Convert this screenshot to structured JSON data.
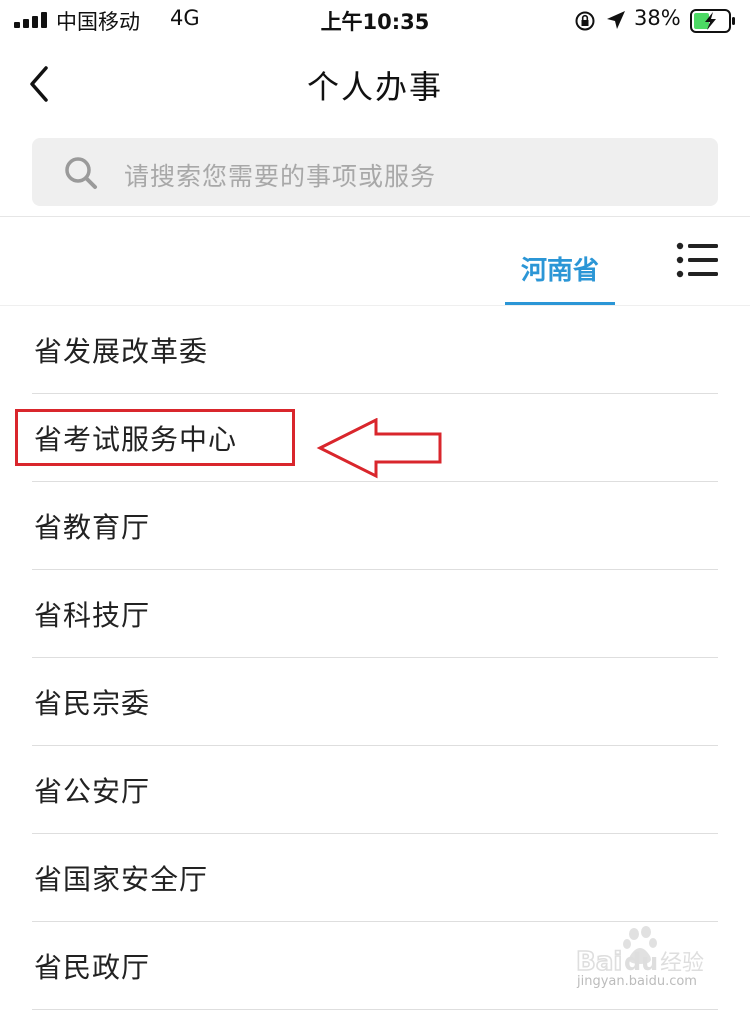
{
  "status_bar": {
    "carrier": "中国移动",
    "network": "4G",
    "time": "上午10:35",
    "battery": "38%"
  },
  "nav": {
    "title": "个人办事",
    "back_icon": "chevron-left-icon"
  },
  "search": {
    "placeholder": "请搜索您需要的事项或服务",
    "icon": "search-icon"
  },
  "region_tab": {
    "label": "河南省",
    "accent_color": "#2b96d6"
  },
  "list": {
    "items": [
      {
        "label": "省发展改革委"
      },
      {
        "label": "省考试服务中心"
      },
      {
        "label": "省教育厅"
      },
      {
        "label": "省科技厅"
      },
      {
        "label": "省民宗委"
      },
      {
        "label": "省公安厅"
      },
      {
        "label": "省国家安全厅"
      },
      {
        "label": "省民政厅"
      }
    ]
  },
  "annotation": {
    "color": "#d9262c"
  },
  "watermark": {
    "brand": "Baidu经验",
    "domain": "jingyan.baidu.com"
  }
}
